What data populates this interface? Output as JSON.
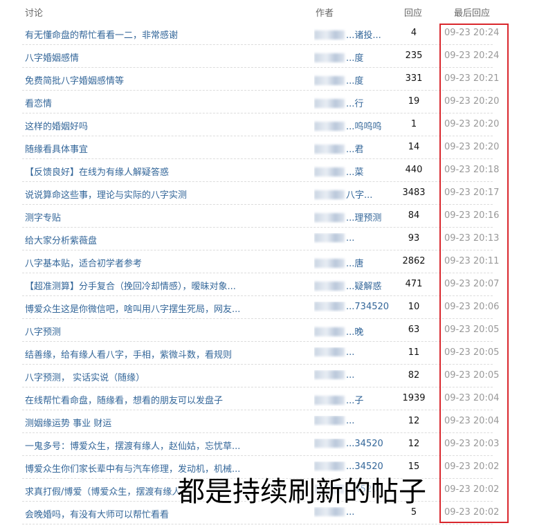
{
  "header": {
    "title_col": "讨论",
    "author_col": "作者",
    "reply_col": "回应",
    "last_col": "最后回应"
  },
  "rows": [
    {
      "title": "有无懂命盘的帮忙看看一二，非常感谢",
      "author": "...诸投...",
      "replies": "4",
      "last": "09-23 20:24"
    },
    {
      "title": "八字婚姻感情",
      "author": "...度",
      "replies": "235",
      "last": "09-23 20:24"
    },
    {
      "title": "免费简批八字婚姻感情等",
      "author": "...度",
      "replies": "331",
      "last": "09-23 20:21"
    },
    {
      "title": "看恋情",
      "author": "...行",
      "replies": "19",
      "last": "09-23 20:20"
    },
    {
      "title": "这样的婚姻好吗",
      "author": "...呜呜呜",
      "replies": "1",
      "last": "09-23 20:20"
    },
    {
      "title": "随缘看具体事宜",
      "author": "...君",
      "replies": "14",
      "last": "09-23 20:20"
    },
    {
      "title": "【反馈良好】在线为有缘人解疑答惑",
      "author": "...菜",
      "replies": "440",
      "last": "09-23 20:18"
    },
    {
      "title": "说说算命这些事，理论与实际的八字实测",
      "author": "八字...",
      "replies": "3483",
      "last": "09-23 20:17"
    },
    {
      "title": "测字专贴",
      "author": "...理预测",
      "replies": "84",
      "last": "09-23 20:16"
    },
    {
      "title": "给大家分析紫薇盘",
      "author": "...",
      "replies": "93",
      "last": "09-23 20:13"
    },
    {
      "title": "八字基本贴，适合初学者参考",
      "author": "...唐",
      "replies": "2862",
      "last": "09-23 20:11"
    },
    {
      "title": "【超准测算】分手复合（挽回冷却情感），暧昧对象...",
      "author": "...疑解惑",
      "replies": "471",
      "last": "09-23 20:07"
    },
    {
      "title": "博爱众生这是你微信吧，啥叫用八字摆生死局，网友...",
      "author": "...734520",
      "replies": "10",
      "last": "09-23 20:06"
    },
    {
      "title": "八字预测",
      "author": "...晚",
      "replies": "63",
      "last": "09-23 20:05"
    },
    {
      "title": "结善缘，给有缘人看八字，手相，紫微斗数，看规则",
      "author": "...",
      "replies": "11",
      "last": "09-23 20:05"
    },
    {
      "title": "八字预测， 实话实说（随缘）",
      "author": "...",
      "replies": "82",
      "last": "09-23 20:05"
    },
    {
      "title": "在线帮忙看命盘，随缘看，想看的朋友可以发盘子",
      "author": "...子",
      "replies": "1939",
      "last": "09-23 20:04"
    },
    {
      "title": "测姻缘运势 事业 财运",
      "author": "...",
      "replies": "12",
      "last": "09-23 20:04"
    },
    {
      "title": "一鬼多号：博爱众生，摆渡有缘人，赵仙姑，忘忧草...",
      "author": "...34520",
      "replies": "12",
      "last": "09-23 20:03"
    },
    {
      "title": "博爱众生你们家长辈中有与汽车修理，发动机，机械...",
      "author": "...34520",
      "replies": "15",
      "last": "09-23 20:02"
    },
    {
      "title": "求真打假/博爱（博爱众生，摆渡有缘人...",
      "author": "...4520",
      "replies": "",
      "last": "09-23 20:02"
    },
    {
      "title": "会晚婚吗，有没有大师可以帮忙看看",
      "author": "...",
      "replies": "5",
      "last": "09-23 20:02"
    }
  ],
  "caption": "都是持续刷新的帖子",
  "colors": {
    "link": "#336699",
    "highlight_box": "#d9262c",
    "muted": "#999999"
  }
}
